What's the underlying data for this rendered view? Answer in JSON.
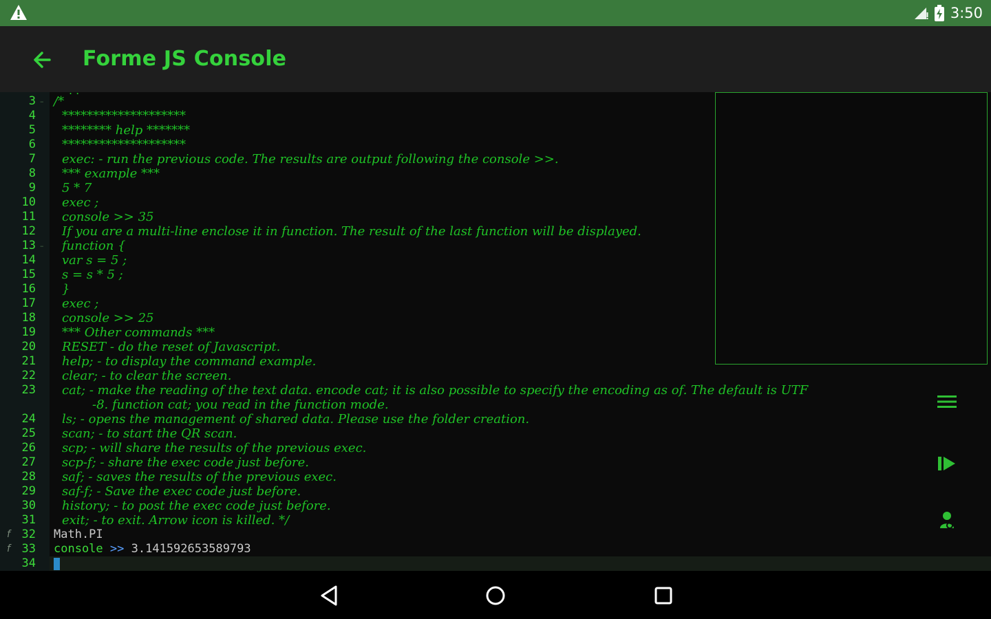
{
  "status_bar": {
    "time": "3:50",
    "warning_icon": "warning-triangle-icon",
    "signal_icon": "cell-signal-icon",
    "battery_icon": "battery-charging-icon"
  },
  "app_bar": {
    "title": "Forme JS Console",
    "back_icon": "arrow-back-icon",
    "accent_color": "#35d23c"
  },
  "editor": {
    "lines": [
      {
        "num": "3",
        "text": "/*",
        "fold": true
      },
      {
        "num": "4",
        "text": "********************"
      },
      {
        "num": "5",
        "text": "******** help *******"
      },
      {
        "num": "6",
        "text": "********************"
      },
      {
        "num": "7",
        "text": "exec: - run the previous code. The results are output following the console >>."
      },
      {
        "num": "8",
        "text": "*** example ***"
      },
      {
        "num": "9",
        "text": "5 * 7"
      },
      {
        "num": "10",
        "text": "exec ;"
      },
      {
        "num": "11",
        "text": "console >> 35"
      },
      {
        "num": "12",
        "text": "If you are a multi-line enclose it in function. The result of the last function will be displayed."
      },
      {
        "num": "13",
        "text": "function {",
        "fold": true
      },
      {
        "num": "14",
        "text": "var s = 5 ;"
      },
      {
        "num": "15",
        "text": "s = s * 5 ;"
      },
      {
        "num": "16",
        "text": "}"
      },
      {
        "num": "17",
        "text": "exec ;"
      },
      {
        "num": "18",
        "text": "console >> 25"
      },
      {
        "num": "19",
        "text": "*** Other commands ***"
      },
      {
        "num": "20",
        "text": "RESET - do the reset of Javascript."
      },
      {
        "num": "21",
        "text": "help; - to display the command example."
      },
      {
        "num": "22",
        "text": "clear; - to clear the screen."
      },
      {
        "num": "23",
        "text": "cat; - make the reading of the text data. encode cat; it is also possible to specify the encoding as of. The default is UTF"
      },
      {
        "num": "",
        "text": "-8. function cat; you read in the function mode.",
        "wrap": true
      },
      {
        "num": "24",
        "text": "ls; - opens the management of shared data. Please use the folder creation."
      },
      {
        "num": "25",
        "text": "scan; - to start the QR scan."
      },
      {
        "num": "26",
        "text": "scp; - will share the results of the previous exec."
      },
      {
        "num": "27",
        "text": "scp-f; - share the exec code just before."
      },
      {
        "num": "28",
        "text": "saf; - saves the results of the previous exec."
      },
      {
        "num": "29",
        "text": "saf-f; - Save the exec code just before."
      },
      {
        "num": "30",
        "text": "history; - to post the exec code just before."
      },
      {
        "num": "31",
        "text": "exit; - to exit. Arrow icon is killed. */"
      },
      {
        "num": "32",
        "text": "Math.PI",
        "plain": true,
        "fmark": "f"
      },
      {
        "num": "33",
        "console_kw": "console",
        "console_op": ">>",
        "console_val": "3.141592653589793",
        "console": true,
        "fmark": "f"
      },
      {
        "num": "34",
        "text": "",
        "cursor": true
      }
    ]
  },
  "controls": [
    {
      "name": "menu-lines-icon"
    },
    {
      "name": "run-play-icon"
    },
    {
      "name": "person-icon"
    }
  ],
  "nav_bar": {
    "back_icon": "nav-back-triangle-icon",
    "home_icon": "nav-home-circle-icon",
    "recents_icon": "nav-recents-square-icon"
  }
}
